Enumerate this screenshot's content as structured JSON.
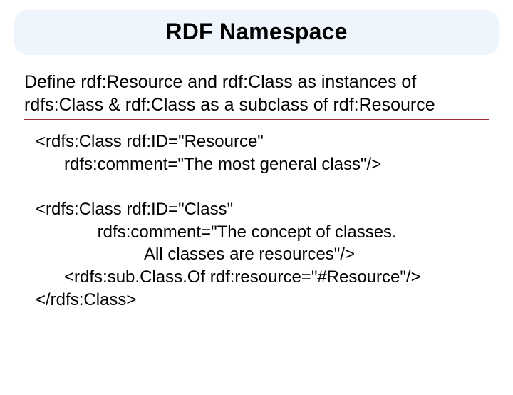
{
  "title": "RDF Namespace",
  "intro_line1": "Define rdf:Resource and rdf:Class as instances of",
  "intro_line2": "rdfs:Class & rdf:Class as a subclass of rdf:Resource",
  "code": {
    "l1": "<rdfs:Class rdf:ID=\"Resource\"",
    "l2": "      rdfs:comment=\"The most general class\"/>",
    "l3": "",
    "l4": "<rdfs:Class rdf:ID=\"Class\"",
    "l5": "             rdfs:comment=\"The concept of classes.",
    "l6": "                       All classes are resources\"/>",
    "l7": "      <rdfs:sub.Class.Of rdf:resource=\"#Resource\"/>",
    "l8": "</rdfs:Class>"
  }
}
